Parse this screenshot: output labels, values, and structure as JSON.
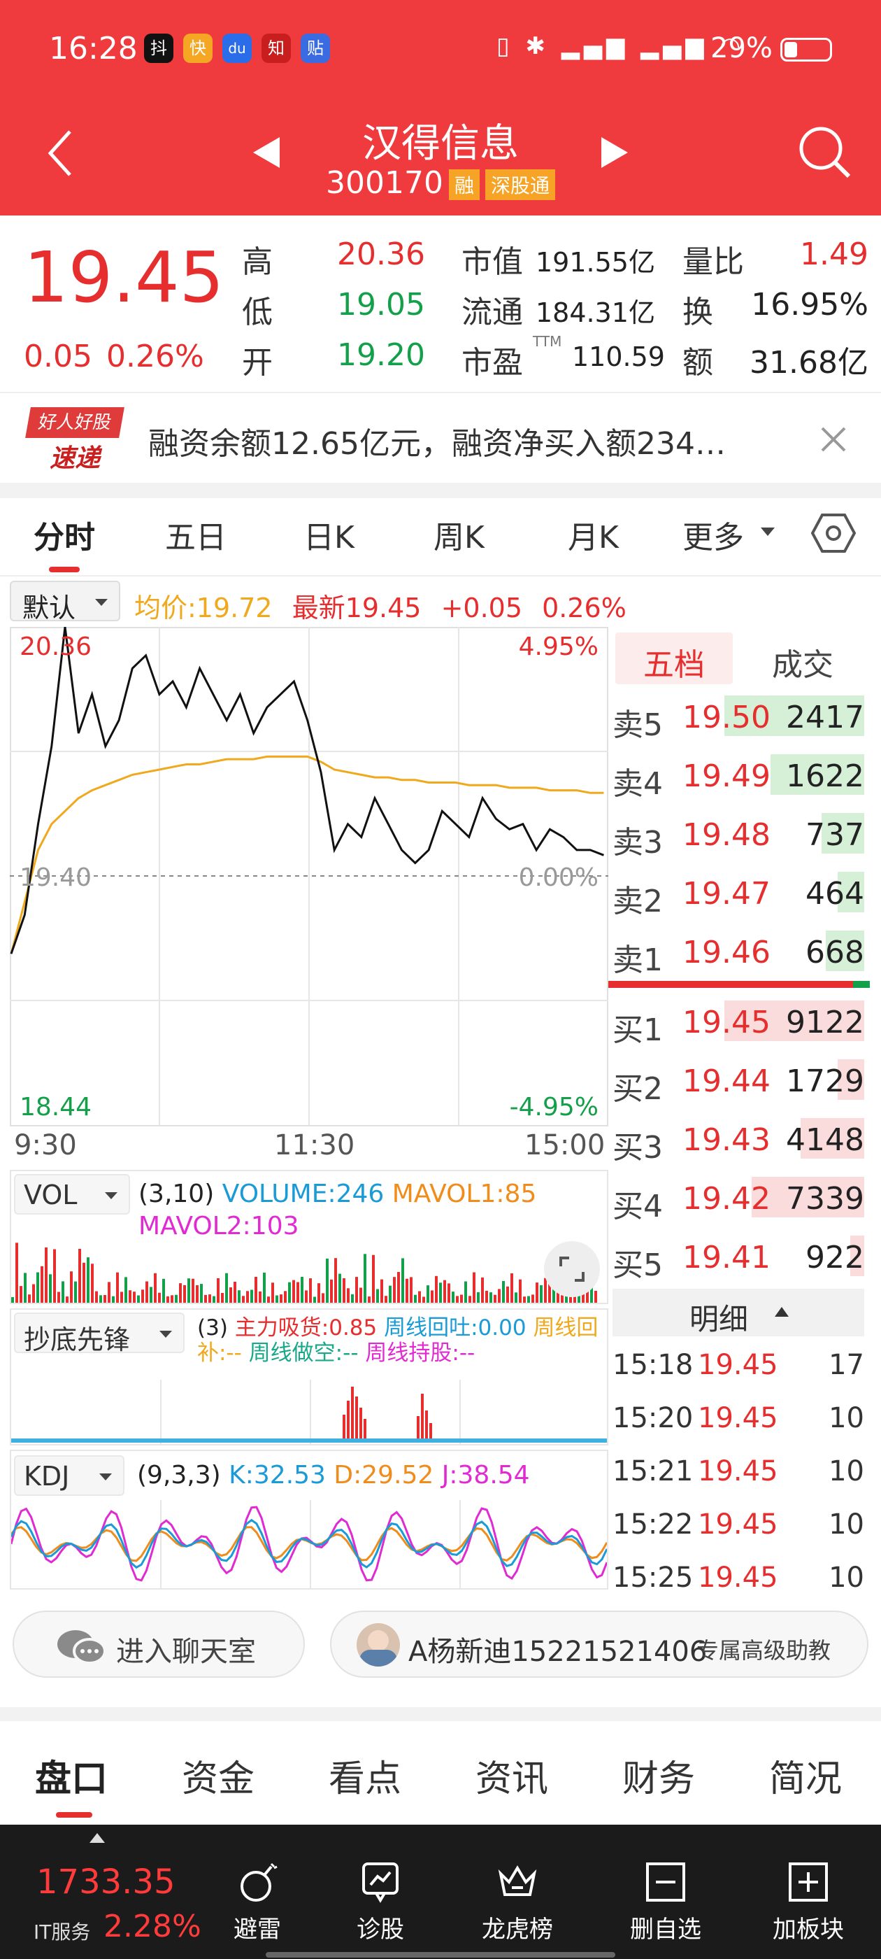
{
  "status_bar": {
    "time": "16:28",
    "battery": "29%",
    "apps": [
      "抖",
      "快",
      "du",
      "知",
      "贴"
    ]
  },
  "header": {
    "stock_name": "汉得信息",
    "stock_code": "300170",
    "tags": [
      "融",
      "深股通"
    ]
  },
  "quote": {
    "price": "19.45",
    "change": "0.05",
    "change_pct": "0.26%",
    "high_label": "高",
    "high": "20.36",
    "low_label": "低",
    "low": "19.05",
    "open_label": "开",
    "open": "19.20",
    "mktcap_label": "市值",
    "mktcap": "191.55亿",
    "float_label": "流通",
    "float": "184.31亿",
    "pe_label": "市盈",
    "pe_sup": "TTM",
    "pe": "110.59",
    "vr_label": "量比",
    "vr": "1.49",
    "turnover_label": "换",
    "turnover": "16.95%",
    "amount_label": "额",
    "amount": "31.68亿"
  },
  "news": {
    "badge_top": "好人好股",
    "badge_bottom": "速递",
    "text": "融资余额12.65亿元，融资净买入额234…"
  },
  "chart_tabs": {
    "items": [
      "分时",
      "五日",
      "日K",
      "周K",
      "月K",
      "更多"
    ],
    "active": 0
  },
  "chart_header": {
    "mode": "默认",
    "avg_label": "均价:19.72",
    "latest_label": "最新19.45",
    "change": "+0.05",
    "change_pct": "0.26%"
  },
  "chart_data": {
    "type": "line",
    "x_ticks": [
      "9:30",
      "11:30",
      "15:00"
    ],
    "y_max": "20.36",
    "y_min": "18.44",
    "y_base": "19.40",
    "pct_max": "4.95%",
    "pct_base": "0.00%",
    "pct_min": "-4.95%",
    "ylim": [
      18.44,
      20.36
    ],
    "series": [
      {
        "name": "最新",
        "values": [
          19.1,
          19.25,
          19.6,
          19.9,
          20.36,
          19.95,
          20.1,
          19.9,
          20.0,
          20.2,
          20.25,
          20.1,
          20.15,
          20.05,
          20.2,
          20.1,
          20.0,
          20.1,
          19.95,
          20.05,
          20.1,
          20.15,
          20.0,
          19.8,
          19.5,
          19.6,
          19.55,
          19.7,
          19.6,
          19.5,
          19.45,
          19.5,
          19.65,
          19.6,
          19.55,
          19.7,
          19.62,
          19.58,
          19.6,
          19.5,
          19.58,
          19.55,
          19.5,
          19.5,
          19.48
        ]
      },
      {
        "name": "均价",
        "values": [
          19.1,
          19.3,
          19.5,
          19.6,
          19.65,
          19.7,
          19.73,
          19.75,
          19.77,
          19.79,
          19.8,
          19.81,
          19.82,
          19.83,
          19.83,
          19.84,
          19.85,
          19.85,
          19.85,
          19.86,
          19.86,
          19.86,
          19.86,
          19.84,
          19.81,
          19.8,
          19.79,
          19.78,
          19.78,
          19.77,
          19.77,
          19.76,
          19.76,
          19.76,
          19.75,
          19.75,
          19.75,
          19.74,
          19.74,
          19.74,
          19.73,
          19.73,
          19.73,
          19.72,
          19.72
        ]
      }
    ]
  },
  "orderbook": {
    "tabs": [
      "五档",
      "成交"
    ],
    "asks": [
      {
        "name": "卖5",
        "price": "19.50",
        "vol": "2417"
      },
      {
        "name": "卖4",
        "price": "19.49",
        "vol": "1622"
      },
      {
        "name": "卖3",
        "price": "19.48",
        "vol": "737"
      },
      {
        "name": "卖2",
        "price": "19.47",
        "vol": "464"
      },
      {
        "name": "卖1",
        "price": "19.46",
        "vol": "668"
      }
    ],
    "bids": [
      {
        "name": "买1",
        "price": "19.45",
        "vol": "9122"
      },
      {
        "name": "买2",
        "price": "19.44",
        "vol": "1729"
      },
      {
        "name": "买3",
        "price": "19.43",
        "vol": "4148"
      },
      {
        "name": "买4",
        "price": "19.42",
        "vol": "7339"
      },
      {
        "name": "买5",
        "price": "19.41",
        "vol": "922"
      }
    ],
    "detail_label": "明细",
    "details": [
      {
        "time": "15:18",
        "price": "19.45",
        "vol": "17"
      },
      {
        "time": "15:20",
        "price": "19.45",
        "vol": "10"
      },
      {
        "time": "15:21",
        "price": "19.45",
        "vol": "10"
      },
      {
        "time": "15:22",
        "price": "19.45",
        "vol": "10"
      },
      {
        "time": "15:25",
        "price": "19.45",
        "vol": "10"
      }
    ]
  },
  "vol_panel": {
    "label": "VOL",
    "params": "(3,10)",
    "volume": "VOLUME:246",
    "mavol1": "MAVOL1:85",
    "mavol2": "MAVOL2:103"
  },
  "cdxf_panel": {
    "label": "抄底先锋",
    "params": "(3)",
    "zlxh": "主力吸货:0.85",
    "zxht": "周线回吐:0.00",
    "zxhb": "周线回补:--",
    "zxzk": "周线做空:--",
    "zxcg": "周线持股:--"
  },
  "kdj_panel": {
    "label": "KDJ",
    "params": "(9,3,3)",
    "k": "K:32.53",
    "d": "D:29.52",
    "j": "J:38.54"
  },
  "buttons": {
    "chat": "进入聊天室",
    "advisor_name": "A杨新迪15221521406",
    "advisor_role": "专属高级助教"
  },
  "bottom_tabs": {
    "items": [
      "盘口",
      "资金",
      "看点",
      "资讯",
      "财务",
      "简况"
    ],
    "active": 0
  },
  "index_ticker": {
    "value": "1733.35",
    "name": "IT服务",
    "pct": "2.28%"
  },
  "bottom_nav": {
    "items": [
      "避雷",
      "诊股",
      "龙虎榜",
      "删自选",
      "加板块"
    ]
  },
  "colors": {
    "brand_red": "#ef3a3e",
    "up_red": "#e62e2e",
    "down_green": "#14a04a",
    "avg_line": "#f0a81c",
    "vol_blue": "#1a9bd7",
    "mavol1": "#f08c1c",
    "mavol2": "#e02ad2"
  }
}
